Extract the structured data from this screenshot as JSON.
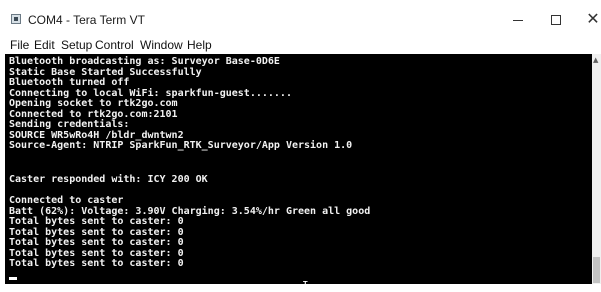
{
  "window": {
    "title": "COM4 - Tera Term VT",
    "icon": "teraterm-app-icon",
    "controls": {
      "minimize": "minimize-icon",
      "maximize": "maximize-icon",
      "close_glyph": "✕"
    }
  },
  "menu": [
    "File",
    "Edit",
    "Setup",
    "Control",
    "Window",
    "Help"
  ],
  "terminal": {
    "lines": [
      "Bluetooth broadcasting as: Surveyor Base-0D6E",
      "Static Base Started Successfully",
      "Bluetooth turned off",
      "Connecting to local WiFi: sparkfun-guest.......",
      "Opening socket to rtk2go.com",
      "Connected to rtk2go.com:2101",
      "Sending credentials:",
      "SOURCE WR5wRo4H /bldr_dwntwn2",
      "Source-Agent: NTRIP SparkFun_RTK_Surveyor/App Version 1.0",
      "",
      "",
      "Caster responded with: ICY 200 OK",
      "",
      "Connected to caster",
      "Batt (62%): Voltage: 3.90V Charging: 3.54%/hr Green all good",
      "Total bytes sent to caster: 0",
      "Total bytes sent to caster: 0",
      "Total bytes sent to caster: 0",
      "Total bytes sent to caster: 0",
      "Total bytes sent to caster: 0"
    ],
    "mouse_cursor_glyph": "I"
  }
}
